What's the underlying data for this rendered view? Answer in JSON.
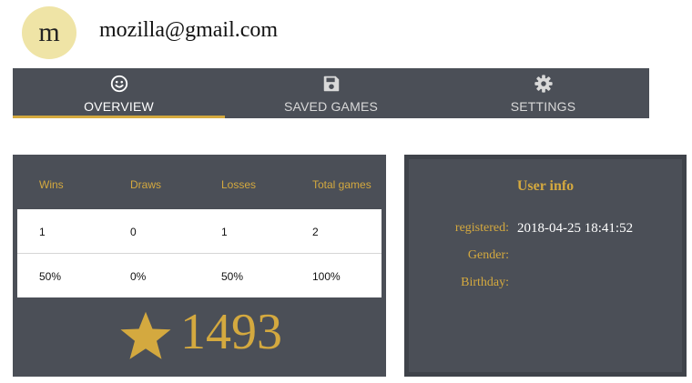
{
  "user": {
    "avatar_letter": "m",
    "email": "mozilla@gmail.com"
  },
  "tabs": [
    {
      "label": "OVERVIEW",
      "icon": "smiley-icon",
      "active": true
    },
    {
      "label": "SAVED GAMES",
      "icon": "floppy-disk-icon",
      "active": false
    },
    {
      "label": "SETTINGS",
      "icon": "gear-icon",
      "active": false
    }
  ],
  "stats": {
    "headers": [
      "Wins",
      "Draws",
      "Losses",
      "Total games"
    ],
    "counts": [
      "1",
      "0",
      "1",
      "2"
    ],
    "percents": [
      "50%",
      "0%",
      "50%",
      "100%"
    ],
    "rating": "1493",
    "rating_icon": "star-icon"
  },
  "user_info": {
    "title": "User info",
    "rows": [
      {
        "label": "registered:",
        "value": "2018-04-25 18:41:52"
      },
      {
        "label": "Gender:",
        "value": ""
      },
      {
        "label": "Birthday:",
        "value": ""
      }
    ]
  },
  "colors": {
    "panel": "#4b4f57",
    "accent": "#d4a93f",
    "avatar_bg": "#efe4a6"
  }
}
